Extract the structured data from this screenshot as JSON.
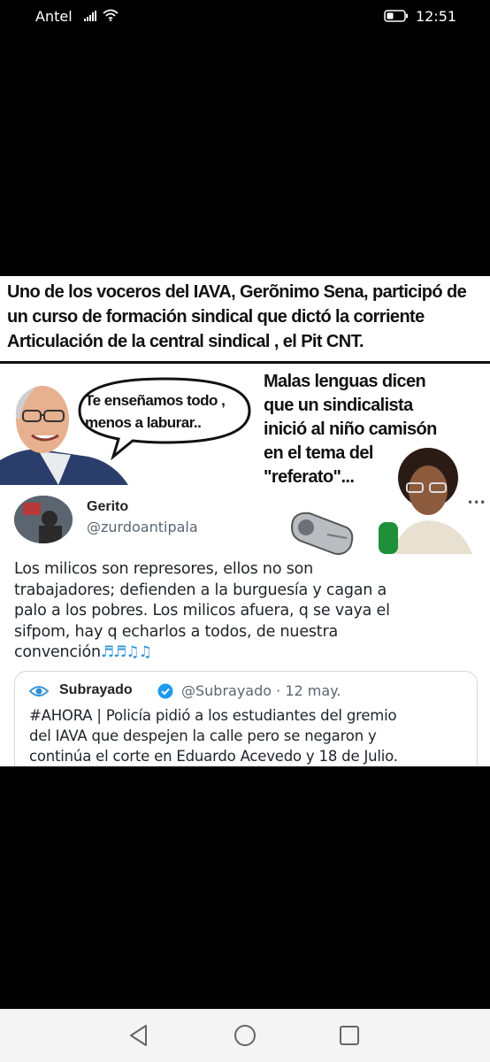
{
  "status_bar": {
    "carrier": "Antel",
    "time": "12:51"
  },
  "meme": {
    "headline_lines": [
      "Uno de los voceros del IAVA, Gerõnimo Sena, participó de",
      "un curso de formación sindical que dictó la corriente",
      "Articulación de la central sindical , el Pit CNT."
    ],
    "speech_bubble_lines": [
      "Te enseñamos todo ,",
      "menos a laburar.."
    ],
    "caption_lines": [
      "Malas lenguas dicen",
      "que un sindicalista",
      "inició al niño camisón",
      "en el tema del",
      "\"referato\"..."
    ]
  },
  "tweet": {
    "display_name": "Gerito",
    "handle": "@zurdoantipala",
    "body_lines": [
      "Los milicos son represores, ellos no son",
      "trabajadores; defienden a la burguesía y cagan a",
      "palo a los pobres. Los milicos afuera, q se vaya el",
      "sifpom, hay q echarlos a todos, de nuestra",
      "convención"
    ],
    "emoji_notes": "♬♬♫♫"
  },
  "quoted_tweet": {
    "name": "Subrayado",
    "handle_date": "@Subrayado · 12 may.",
    "text_lines": [
      "#AHORA | Policía pidió a los estudiantes del gremio",
      "del IAVA que despejen la calle pero se negaron y",
      "continúa el corte en Eduardo Acevedo y 18 de Julio."
    ]
  },
  "colors": {
    "background": "#000000",
    "meme_background": "#ffffff",
    "link_blue": "#2a8fd8",
    "verified_blue": "#1d9bf0",
    "nav_bar": "#f4f4f4"
  }
}
